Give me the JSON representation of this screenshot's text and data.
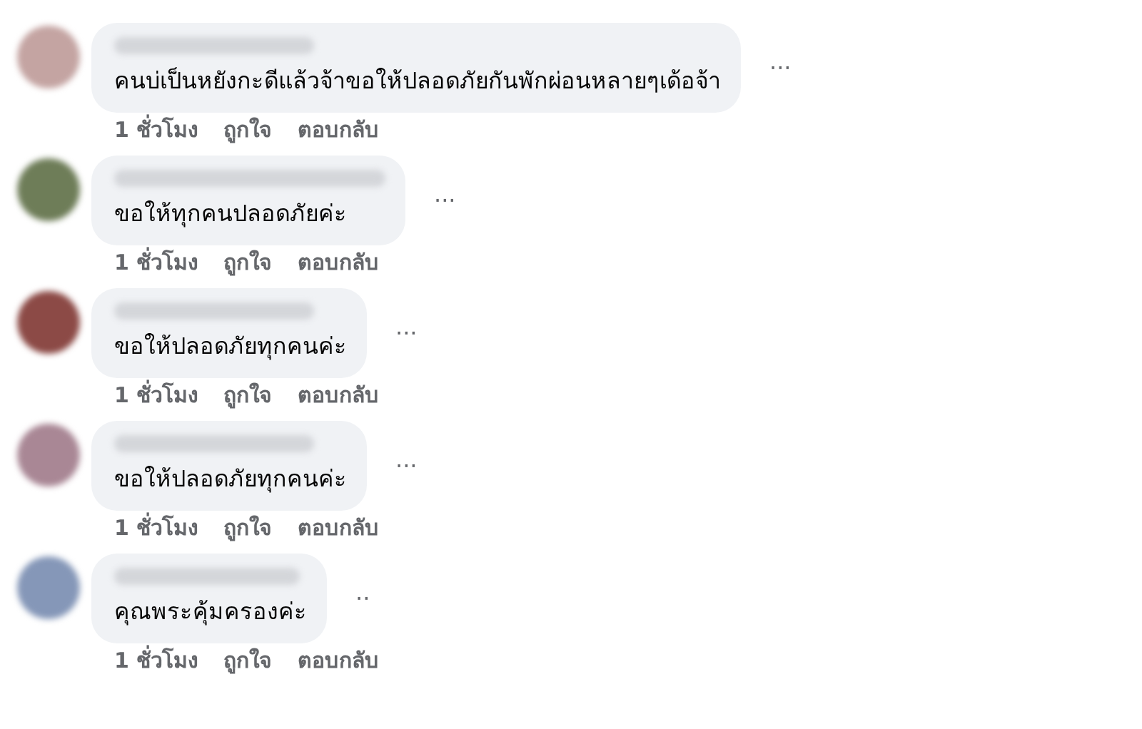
{
  "comments": [
    {
      "text": "คนบ่เป็นหยังกะดีแล้วจ้าขอให้ปลอดภัยกันพักผ่อนหลายๆเด้อจ้า",
      "more": "···",
      "time": "1 ชั่วโมง",
      "like": "ถูกใจ",
      "reply": "ตอบกลับ"
    },
    {
      "text": "ขอให้ทุกคนปลอดภัยค่ะ",
      "more": "···",
      "time": "1 ชั่วโมง",
      "like": "ถูกใจ",
      "reply": "ตอบกลับ"
    },
    {
      "text": "ขอให้ปลอดภัยทุกคนค่ะ",
      "more": "···",
      "time": "1 ชั่วโมง",
      "like": "ถูกใจ",
      "reply": "ตอบกลับ"
    },
    {
      "text": "ขอให้ปลอดภัยทุกคนค่ะ",
      "more": "···",
      "time": "1 ชั่วโมง",
      "like": "ถูกใจ",
      "reply": "ตอบกลับ"
    },
    {
      "text": "คุณพระคุ้มครองค่ะ",
      "more": "··",
      "time": "1 ชั่วโมง",
      "like": "ถูกใจ",
      "reply": "ตอบกลับ"
    }
  ]
}
